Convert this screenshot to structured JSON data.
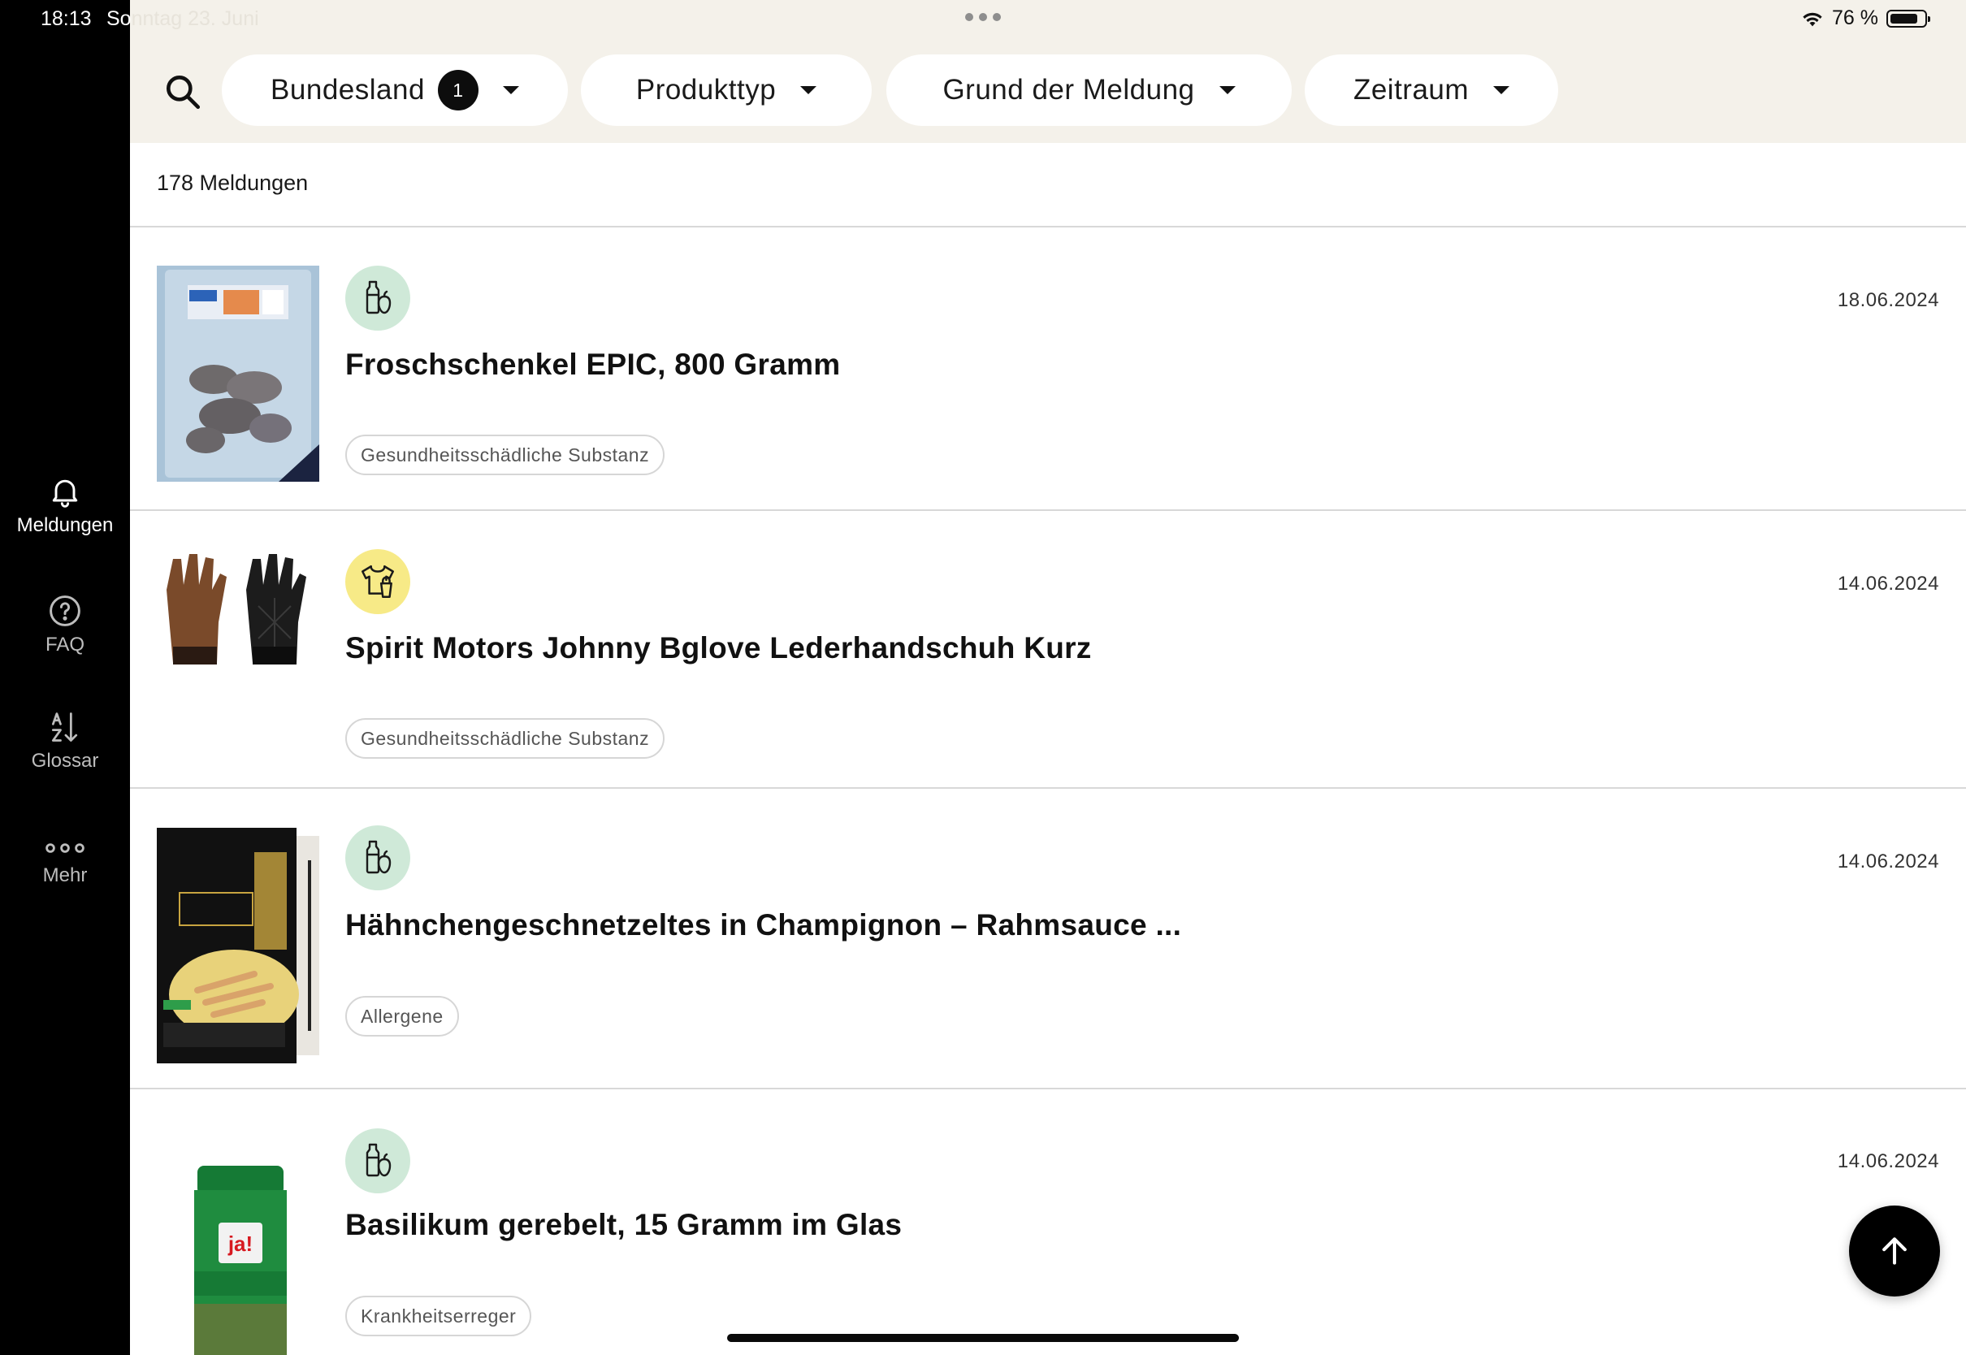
{
  "status_bar": {
    "time": "18:13",
    "date_prefix": "So",
    "date_faded": "nntag 23. Juni",
    "battery_label": "76 %"
  },
  "sidebar": {
    "items": [
      {
        "label": "Meldungen",
        "icon": "bell-icon",
        "active": true
      },
      {
        "label": "FAQ",
        "icon": "help-circle-icon",
        "active": false
      },
      {
        "label": "Glossar",
        "icon": "sort-az-icon",
        "active": false
      },
      {
        "label": "Mehr",
        "icon": "more-dots-icon",
        "active": false
      }
    ]
  },
  "filters": {
    "search_icon": "search-icon",
    "chips": [
      {
        "label": "Bundesland",
        "badge": "1"
      },
      {
        "label": "Produkttyp"
      },
      {
        "label": "Grund der Meldung"
      },
      {
        "label": "Zeitraum"
      }
    ]
  },
  "results": {
    "count_label": "178 Meldungen",
    "items": [
      {
        "title": "Froschschenkel EPIC, 800 Gramm",
        "date": "18.06.2024",
        "tag": "Gesundheitsschädliche Substanz",
        "category_icon": "food-icon",
        "category_color": "#cfe9d8"
      },
      {
        "title": "Spirit Motors Johnny Bglove Lederhandschuh Kurz",
        "date": "14.06.2024",
        "tag": "Gesundheitsschädliche Substanz",
        "category_icon": "clothing-icon",
        "category_color": "#f7ea87"
      },
      {
        "title": "Hähnchengeschnetzeltes in Champignon – Rahmsauce ...",
        "date": "14.06.2024",
        "tag": "Allergene",
        "category_icon": "food-icon",
        "category_color": "#cfe9d8"
      },
      {
        "title": "Basilikum gerebelt, 15 Gramm im Glas",
        "date": "14.06.2024",
        "tag": "Krankheitserreger",
        "category_icon": "food-icon",
        "category_color": "#cfe9d8"
      }
    ]
  },
  "fab": {
    "icon": "arrow-up-icon"
  }
}
